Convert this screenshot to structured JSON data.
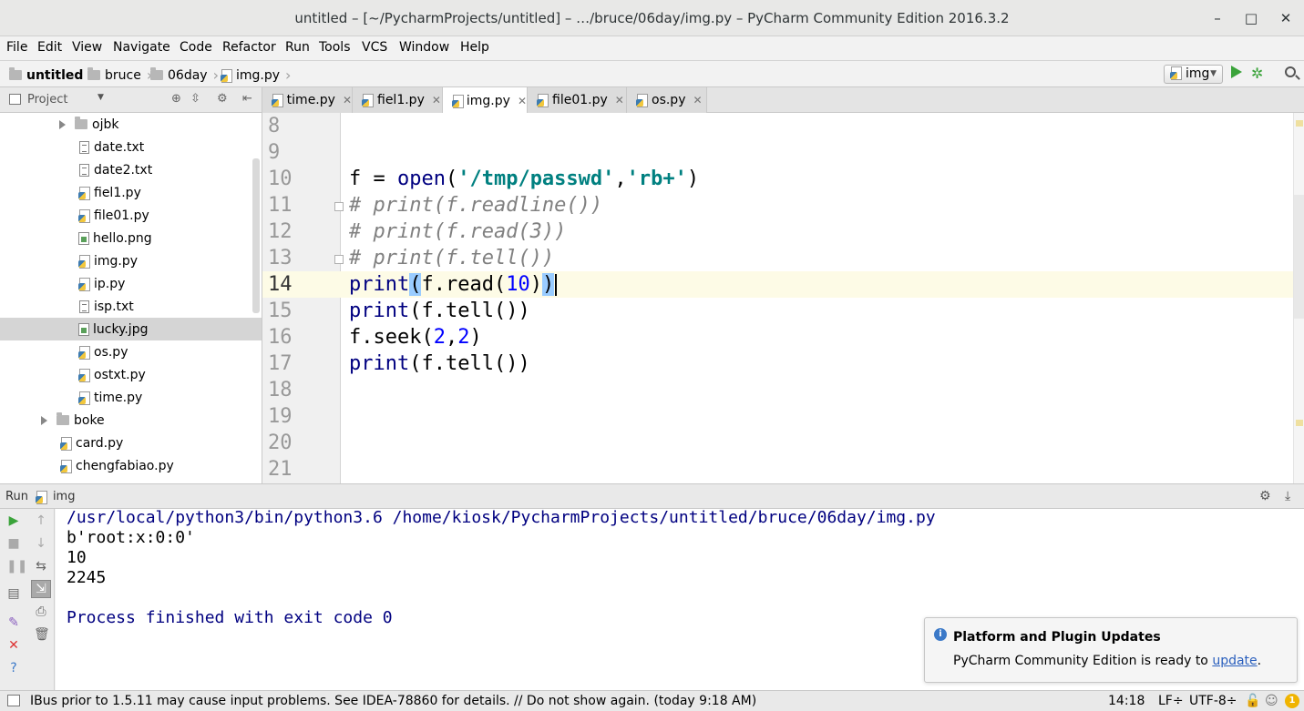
{
  "window": {
    "title": "untitled – [~/PycharmProjects/untitled] – …/bruce/06day/img.py – PyCharm Community Edition 2016.3.2",
    "minimize": "–",
    "maximize": "□",
    "close": "✕"
  },
  "menu": [
    "File",
    "Edit",
    "View",
    "Navigate",
    "Code",
    "Refactor",
    "Run",
    "Tools",
    "VCS",
    "Window",
    "Help"
  ],
  "breadcrumb": [
    "untitled",
    "bruce",
    "06day",
    "img.py"
  ],
  "run_config": "img",
  "project_panel": {
    "title": "Project",
    "tree": [
      {
        "label": "ojbk",
        "type": "folder"
      },
      {
        "label": "date.txt",
        "type": "txt"
      },
      {
        "label": "date2.txt",
        "type": "txt"
      },
      {
        "label": "fiel1.py",
        "type": "py"
      },
      {
        "label": "file01.py",
        "type": "py"
      },
      {
        "label": "hello.png",
        "type": "img"
      },
      {
        "label": "img.py",
        "type": "py"
      },
      {
        "label": "ip.py",
        "type": "py"
      },
      {
        "label": "isp.txt",
        "type": "txt"
      },
      {
        "label": "lucky.jpg",
        "type": "img",
        "selected": true
      },
      {
        "label": "os.py",
        "type": "py"
      },
      {
        "label": "ostxt.py",
        "type": "py"
      },
      {
        "label": "time.py",
        "type": "py"
      },
      {
        "label": "boke",
        "type": "folder"
      },
      {
        "label": "card.py",
        "type": "py"
      },
      {
        "label": "chengfabiao.py",
        "type": "py"
      }
    ]
  },
  "tabs": [
    "time.py",
    "fiel1.py",
    "img.py",
    "file01.py",
    "os.py"
  ],
  "active_tab": "img.py",
  "editor": {
    "line_numbers": [
      "8",
      "9",
      "10",
      "11",
      "12",
      "13",
      "14",
      "15",
      "16",
      "17",
      "18",
      "19",
      "20",
      "21"
    ],
    "current_line": "14",
    "code": {
      "l10": {
        "var": "f = ",
        "fn": "open",
        "p1": "(",
        "s1": "'/tmp/passwd'",
        "comma": ",",
        "s2": "'rb+'",
        "p2": ")"
      },
      "l11": "# print(f.readline())",
      "l12": "# print(f.read(3))",
      "l13": "# print(f.tell())",
      "l14": {
        "fn": "print",
        "lp": "(",
        "mid": "f.read(",
        "num": "10",
        "close": ")",
        "rp": ")"
      },
      "l15": {
        "fn": "print",
        "rest": "(f.tell())"
      },
      "l16": {
        "pre": "f.seek(",
        "n1": "2",
        "comma": ",",
        "n2": "2",
        "post": ")"
      },
      "l17": {
        "fn": "print",
        "rest": "(f.tell())"
      }
    }
  },
  "run_panel": {
    "label": "Run",
    "config": "img",
    "output": [
      "/usr/local/python3/bin/python3.6 /home/kiosk/PycharmProjects/untitled/bruce/06day/img.py",
      "b'root:x:0:0'",
      "10",
      "2245",
      "",
      "Process finished with exit code 0"
    ]
  },
  "notification": {
    "title": "Platform and Plugin Updates",
    "body": "PyCharm Community Edition is ready to ",
    "link": "update",
    "suffix": "."
  },
  "status": {
    "message": "IBus prior to 1.5.11 may cause input problems. See IDEA-78860 for details. // Do not show again. (today 9:18 AM)",
    "position": "14:18",
    "line_sep": "LF÷",
    "encoding": "UTF-8÷",
    "event_count": "1"
  }
}
